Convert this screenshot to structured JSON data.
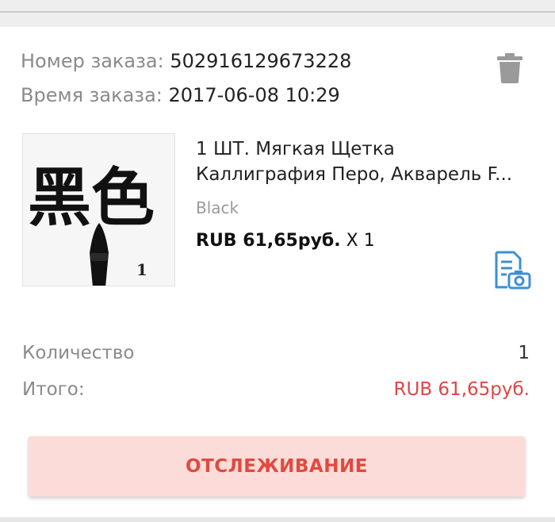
{
  "order": {
    "number_label": "Номер заказа:",
    "number_value": "502916129673228",
    "time_label": "Время заказа:",
    "time_value": "2017-06-08 10:29"
  },
  "product": {
    "title": "1 ШТ. Мягкая Щетка Каллиграфия Перо, Акварель F...",
    "variant": "Black",
    "price": "RUB 61,65руб.",
    "quantity_mult": "X 1",
    "image_chars": "黑色",
    "image_number": "1"
  },
  "summary": {
    "quantity_label": "Количество",
    "quantity_value": "1",
    "total_label": "Итого:",
    "total_value": "RUB 61,65руб."
  },
  "actions": {
    "track_label": "ОТСЛЕЖИВАНИЕ"
  },
  "icons": {
    "delete": "trash-icon",
    "photo_review": "document-camera-icon"
  },
  "colors": {
    "accent_red": "#e04545",
    "button_bg": "#fcdcd8",
    "icon_blue": "#3d8fd6",
    "icon_grey": "#9a9a9a"
  }
}
